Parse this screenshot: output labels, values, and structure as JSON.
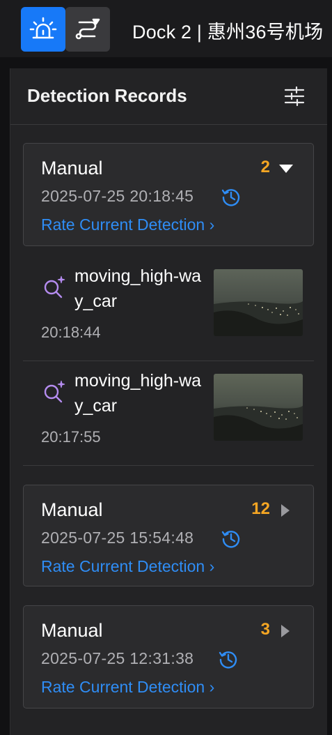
{
  "topbar": {
    "alarm_icon": "alarm-siren-icon",
    "route_icon": "route-waypoint-icon",
    "dock_title": "Dock 2 | 惠州36号机场"
  },
  "panel": {
    "title": "Detection Records",
    "filter_icon": "sliders-filter-icon"
  },
  "groups": [
    {
      "title": "Manual",
      "count": "2",
      "expanded": true,
      "timestamp": "2025-07-25 20:18:45",
      "rate_label": "Rate Current Detection",
      "records": [
        {
          "name": "moving_high-way_car",
          "time": "20:18:44"
        },
        {
          "name": "moving_high-way_car",
          "time": "20:17:55"
        }
      ]
    },
    {
      "title": "Manual",
      "count": "12",
      "expanded": false,
      "timestamp": "2025-07-25 15:54:48",
      "rate_label": "Rate Current Detection"
    },
    {
      "title": "Manual",
      "count": "3",
      "expanded": false,
      "timestamp": "2025-07-25 12:31:38",
      "rate_label": "Rate Current Detection"
    }
  ],
  "colors": {
    "accent": "#1779f8",
    "count": "#f5a623",
    "link": "#2f8df5",
    "ai_icon": "#b58cf0"
  }
}
